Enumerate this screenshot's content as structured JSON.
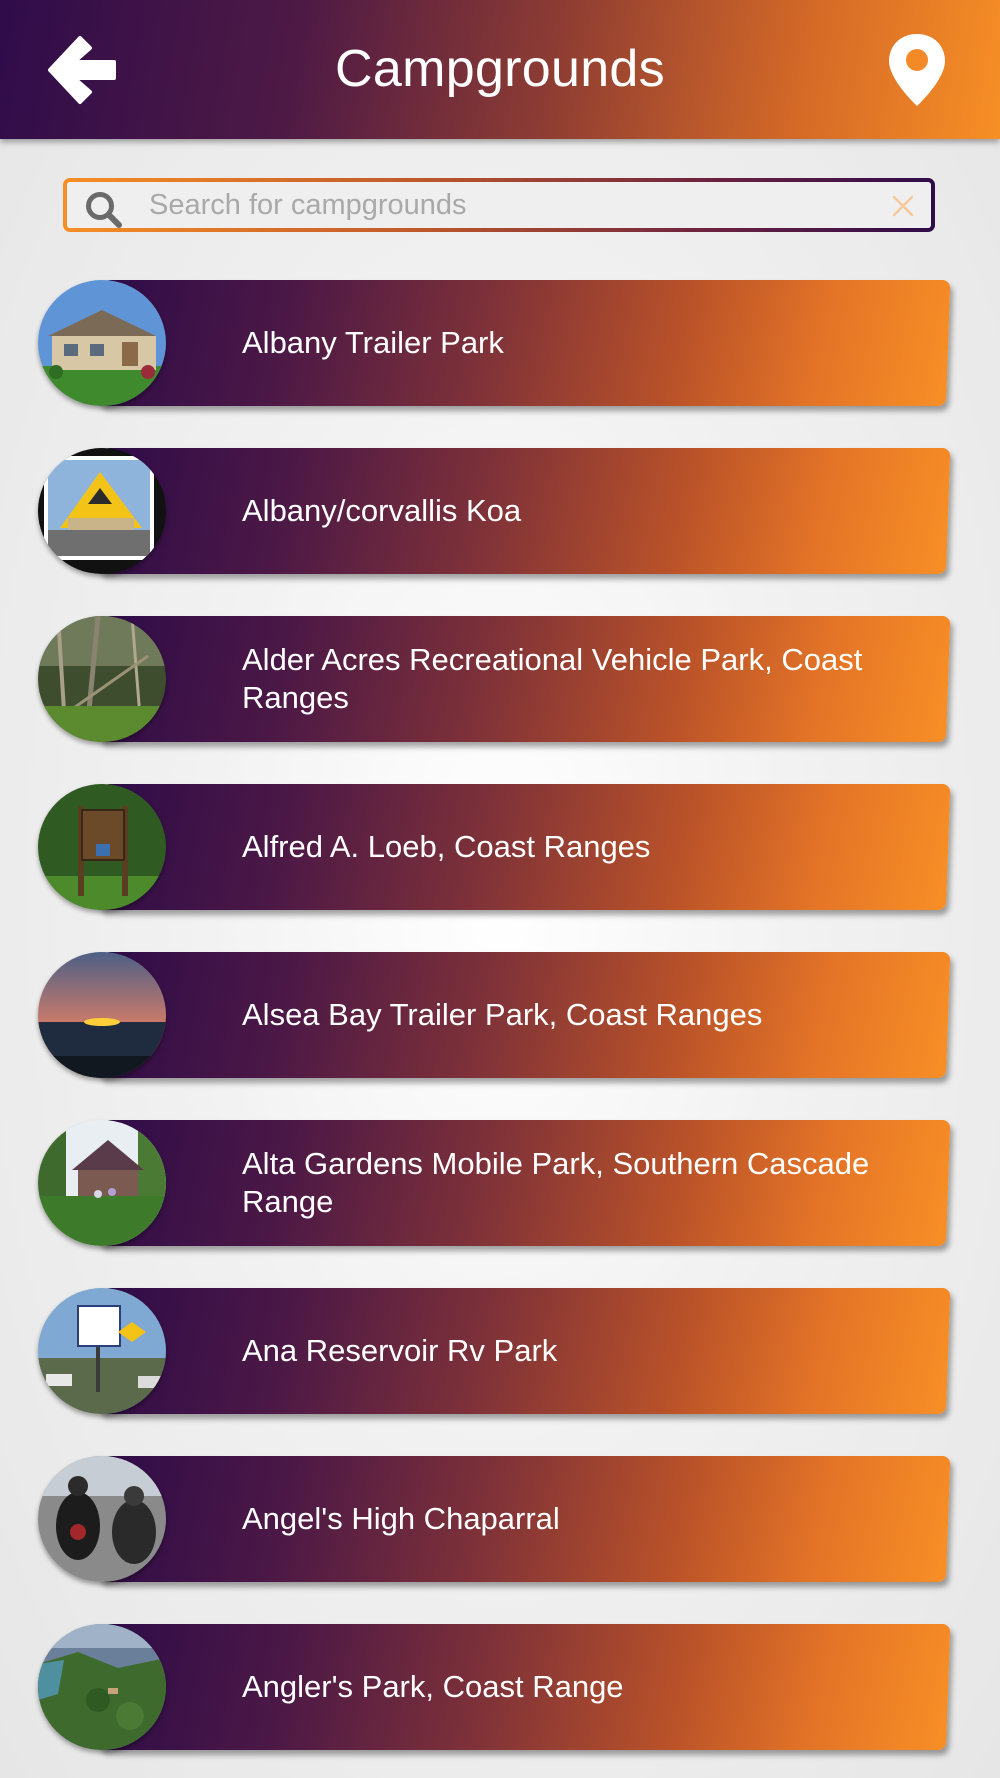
{
  "header": {
    "title": "Campgrounds",
    "back_icon": "arrow-left-icon",
    "map_icon": "map-pin-icon",
    "gradient_start": "#2f0c4a",
    "gradient_end": "#f78f26"
  },
  "search": {
    "placeholder": "Search for campgrounds",
    "value": "",
    "search_icon": "magnifier-icon",
    "clear_icon": "close-icon"
  },
  "campgrounds": [
    {
      "name": "Albany Trailer Park",
      "thumb": "mobile-home-photo"
    },
    {
      "name": "Albany/corvallis Koa",
      "thumb": "koa-lodge-photo"
    },
    {
      "name": "Alder Acres Recreational Vehicle Park, Coast Ranges",
      "thumb": "forest-photo"
    },
    {
      "name": "Alfred A. Loeb, Coast Ranges",
      "thumb": "park-sign-photo"
    },
    {
      "name": "Alsea Bay Trailer Park, Coast Ranges",
      "thumb": "sunset-ocean-photo"
    },
    {
      "name": "Alta Gardens Mobile Park, Southern Cascade Range",
      "thumb": "garden-house-photo"
    },
    {
      "name": "Ana Reservoir Rv Park",
      "thumb": "rv-park-sign-photo"
    },
    {
      "name": "Angel's High Chaparral",
      "thumb": "bikers-photo"
    },
    {
      "name": "Angler's Park, Coast Range",
      "thumb": "coastal-aerial-photo"
    }
  ]
}
